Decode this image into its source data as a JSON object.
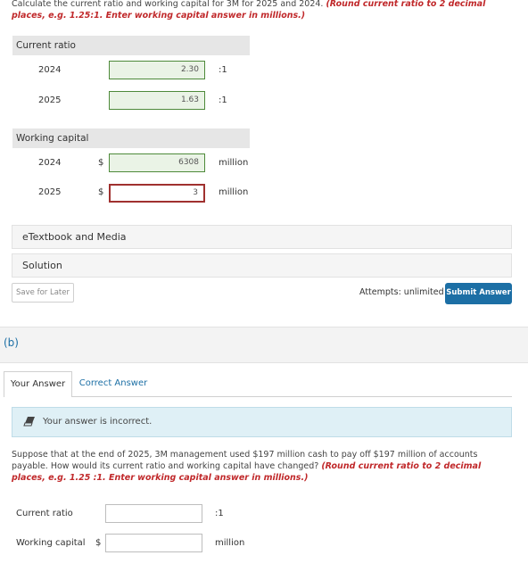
{
  "part_a": {
    "instruction": "Calculate the current ratio and working capital for 3M for 2025 and 2024.",
    "instruction_note": "(Round current ratio to 2 decimal places, e.g. 1.25:1. Enter working capital answer in millions.)",
    "current_ratio": {
      "header": "Current ratio",
      "rows": [
        {
          "year": "2024",
          "value": "2.30",
          "unit": ":1",
          "status": "correct"
        },
        {
          "year": "2025",
          "value": "1.63",
          "unit": ":1",
          "status": "correct"
        }
      ]
    },
    "working_capital": {
      "header": "Working capital",
      "rows": [
        {
          "year": "2024",
          "dollar": "$",
          "value": "6308",
          "unit": "million",
          "status": "correct"
        },
        {
          "year": "2025",
          "dollar": "$",
          "value": "3",
          "unit": "million",
          "status": "incorrect"
        }
      ]
    },
    "etextbook_label": "eTextbook and Media",
    "solution_label": "Solution",
    "save_label": "Save for Later",
    "attempts_text": "Attempts: unlimited",
    "submit_label": "Submit Answer"
  },
  "part_b": {
    "label": "(b)",
    "tabs": [
      {
        "label": "Your Answer",
        "active": true
      },
      {
        "label": "Correct Answer",
        "active": false
      }
    ],
    "incorrect_message": "Your answer is incorrect.",
    "question": "Suppose that at the end of 2025, 3M management used $197 million cash to pay off $197 million of accounts payable. How would its current ratio and working capital have changed?",
    "question_note": "(Round current ratio to 2 decimal places, e.g. 1.25 :1. Enter working capital answer in millions.)",
    "current_ratio_label": "Current ratio",
    "current_ratio_value": "",
    "current_ratio_unit": ":1",
    "working_capital_label": "Working capital",
    "working_capital_dollar": "$",
    "working_capital_value": "",
    "working_capital_unit": "million"
  },
  "icons": {
    "incorrect": "eraser-icon"
  },
  "colors": {
    "accent": "#1c6fa5",
    "error": "#c0282a",
    "correct_border": "#4e8a3a",
    "wrong_border": "#a0312f",
    "info_bg": "#dff0f6"
  }
}
